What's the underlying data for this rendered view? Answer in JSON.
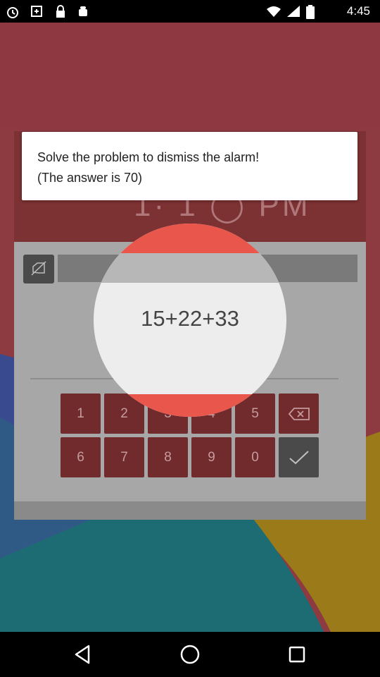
{
  "status_bar": {
    "time": "4:45",
    "icons": [
      "alarm-icon",
      "sync-icon",
      "lock-icon",
      "android-icon",
      "wifi-icon",
      "signal-icon",
      "battery-icon"
    ]
  },
  "alarm": {
    "clock_fragment": "1· 1 ◯ PM",
    "problem": "15+22+33",
    "answer_value": "",
    "keys_row1": [
      "1",
      "2",
      "3",
      "4",
      "5"
    ],
    "keys_row2": [
      "6",
      "7",
      "8",
      "9",
      "0"
    ]
  },
  "dialog": {
    "message": "Solve the problem to dismiss the alarm!\n(The answer is 70)"
  },
  "nav": {
    "icons": [
      "back-icon",
      "home-icon",
      "recents-icon"
    ]
  },
  "colors": {
    "header_red": "#7c3133",
    "key_red": "#722b2d",
    "circle_accent": "#e9574c"
  }
}
